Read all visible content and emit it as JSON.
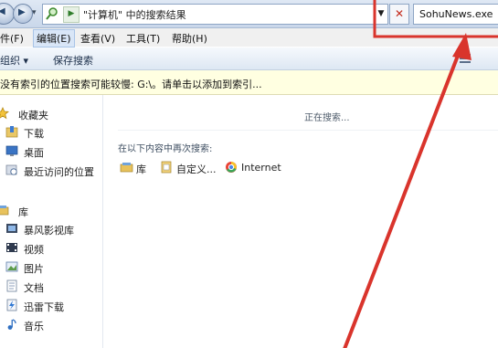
{
  "address_bar": {
    "path_text": "\"计算机\" 中的搜索结果",
    "search_value": "SohuNews.exe"
  },
  "menu": {
    "items": [
      {
        "label": "件(F)"
      },
      {
        "label": "编辑(E)"
      },
      {
        "label": "查看(V)"
      },
      {
        "label": "工具(T)"
      },
      {
        "label": "帮助(H)"
      }
    ]
  },
  "toolbar": {
    "organize_label": "组织 ▾",
    "save_search_label": "保存搜索"
  },
  "infobar": {
    "message": "没有索引的位置搜索可能较慢: G:\\。请单击以添加到索引..."
  },
  "navigation": {
    "favorites_label": "收藏夹",
    "favorites": [
      {
        "label": "下载",
        "icon": "download-folder-icon"
      },
      {
        "label": "桌面",
        "icon": "desktop-icon"
      },
      {
        "label": "最近访问的位置",
        "icon": "recent-places-icon"
      }
    ],
    "libraries_label": "库",
    "libraries": [
      {
        "label": "暴风影视库",
        "icon": "video-library-icon"
      },
      {
        "label": "视频",
        "icon": "video-icon"
      },
      {
        "label": "图片",
        "icon": "pictures-icon"
      },
      {
        "label": "文档",
        "icon": "documents-icon"
      },
      {
        "label": "迅雷下载",
        "icon": "thunder-download-icon"
      },
      {
        "label": "音乐",
        "icon": "music-icon"
      }
    ]
  },
  "content": {
    "status": "正在搜索...",
    "search_again_label": "在以下内容中再次搜索:",
    "locations": [
      {
        "label": "库",
        "icon": "library-icon"
      },
      {
        "label": "自定义...",
        "icon": "custom-folder-icon"
      },
      {
        "label": "Internet",
        "icon": "internet-icon"
      }
    ]
  },
  "colors": {
    "annotation_red": "#d9342c",
    "infobar_bg": "#ffffe1"
  }
}
